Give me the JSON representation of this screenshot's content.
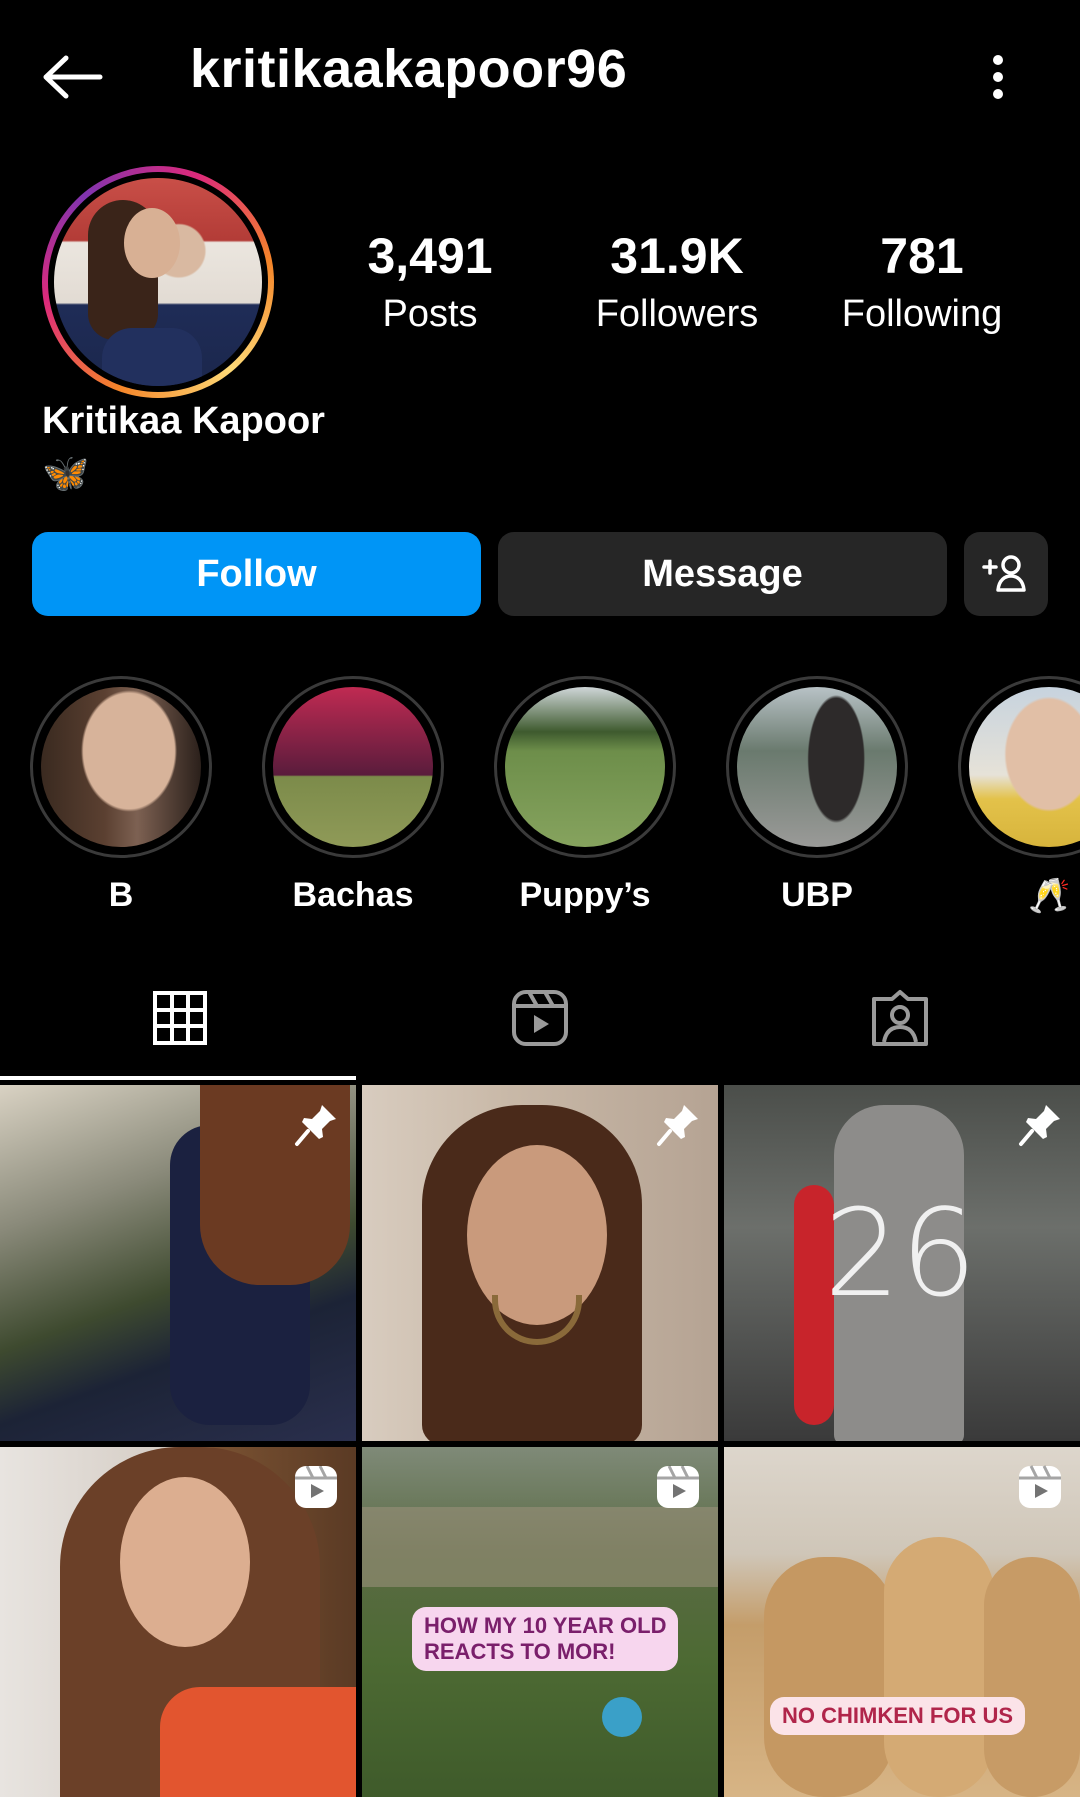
{
  "header": {
    "username": "kritikaakapoor96"
  },
  "profile": {
    "full_name": "Kritikaa Kapoor",
    "bio": "🦋",
    "stats": [
      {
        "value": "3,491",
        "label": "Posts"
      },
      {
        "value": "31.9K",
        "label": "Followers"
      },
      {
        "value": "781",
        "label": "Following"
      }
    ]
  },
  "actions": {
    "follow_label": "Follow",
    "message_label": "Message"
  },
  "highlights": [
    {
      "label": "B"
    },
    {
      "label": "Bachas"
    },
    {
      "label": "Puppy’s"
    },
    {
      "label": "UBP"
    },
    {
      "label": "🥂"
    }
  ],
  "tabs": [
    {
      "icon": "grid-icon",
      "selected": true
    },
    {
      "icon": "reels-icon",
      "selected": false
    },
    {
      "icon": "tagged-icon",
      "selected": false
    }
  ],
  "grid": {
    "stickers": {
      "post5": "HOW MY 10 YEAR OLD\nREACTS TO MOR!",
      "post6": "NO CHIMKEN FOR US"
    },
    "overlay_text": {
      "post3": "26"
    }
  },
  "colors": {
    "follow_button": "#0095f6",
    "secondary_button": "#262626",
    "background": "#000000"
  }
}
